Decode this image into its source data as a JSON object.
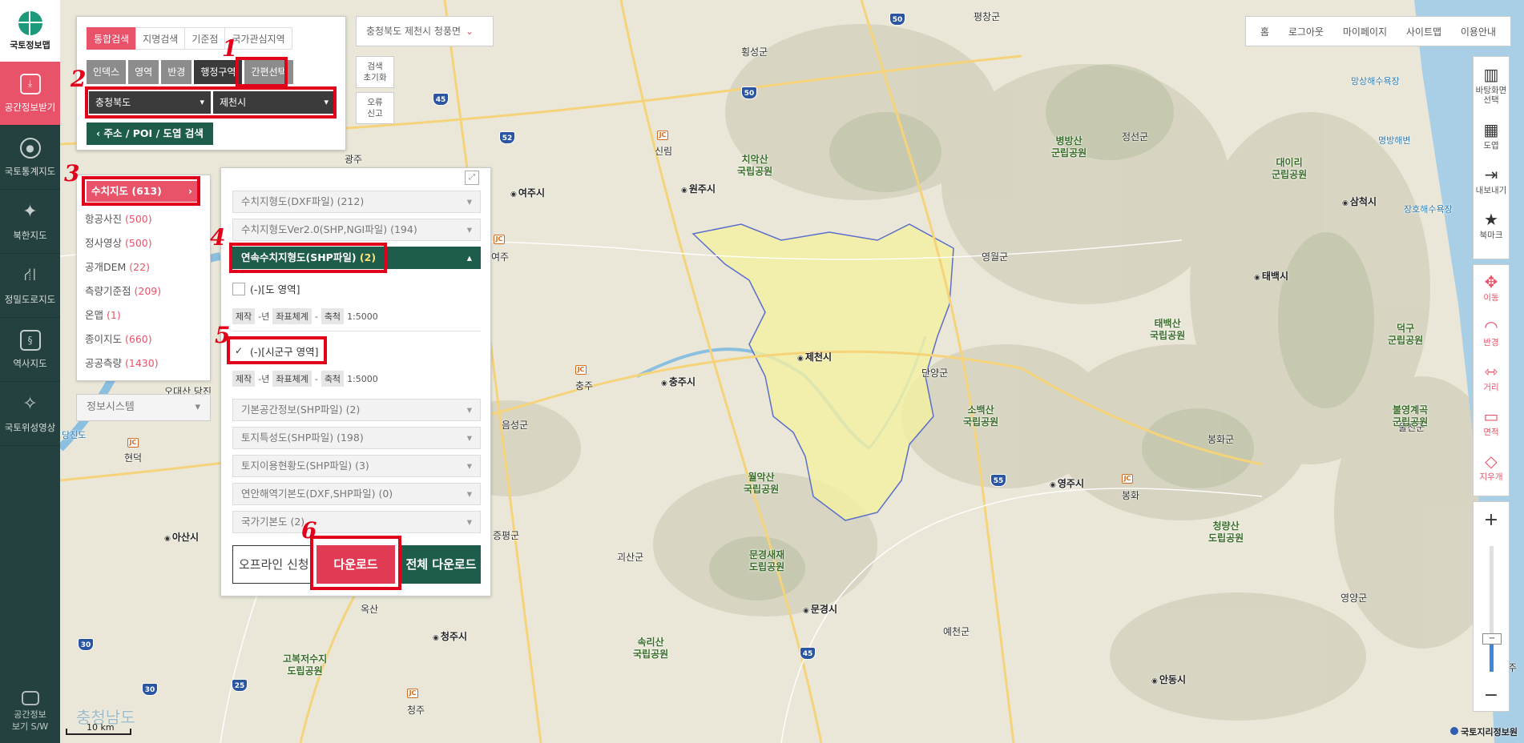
{
  "sidebar": {
    "logo_label": "국토정보맵",
    "items": [
      {
        "label": "공간정보받기",
        "active": true
      },
      {
        "label": "국토통계지도"
      },
      {
        "label": "북한지도"
      },
      {
        "label": "정밀도로지도"
      },
      {
        "label": "역사지도"
      },
      {
        "label": "국토위성영상"
      }
    ],
    "bottom_line1": "공간정보",
    "bottom_line2": "보기 S/W"
  },
  "search": {
    "tabs": [
      "통합검색",
      "지명검색",
      "기준점",
      "국가관심지역"
    ],
    "sub_tabs": [
      "인덱스",
      "영역",
      "반경",
      "행정구역",
      "간편선택"
    ],
    "province": "충청북도",
    "city": "제천시",
    "address_button": "‹  주소 / POI / 도엽 검색"
  },
  "location": {
    "text": "충청북도 제천시 청풍면",
    "chevron": "⌄"
  },
  "mini_buttons": {
    "reset_line1": "검색",
    "reset_line2": "초기화",
    "report_line1": "오류",
    "report_line2": "신고"
  },
  "categories": {
    "items": [
      {
        "name": "수치지도",
        "count": "(613)",
        "active": true
      },
      {
        "name": "항공사진",
        "count": "(500)"
      },
      {
        "name": "정사영상",
        "count": "(500)"
      },
      {
        "name": "공개DEM",
        "count": "(22)"
      },
      {
        "name": "측량기준점",
        "count": "(209)"
      },
      {
        "name": "온맵",
        "count": "(1)"
      },
      {
        "name": "종이지도",
        "count": "(660)"
      },
      {
        "name": "공공측량",
        "count": "(1430)"
      }
    ],
    "arrow": "›",
    "info_system": "정보시스템"
  },
  "download": {
    "expand_icon": "⤢",
    "accordions_top": [
      {
        "name": "수치지형도(DXF파일) (212)"
      },
      {
        "name": "수치지형도Ver2.0(SHP,NGI파일) (194)"
      }
    ],
    "open_accordion": {
      "name": "연속수치지형도(SHP파일)",
      "count": "(2)"
    },
    "items": [
      {
        "label": "(-)[도 영역]",
        "checked": false,
        "check_mark": ""
      },
      {
        "label": "(-)[시군구 영역]",
        "checked": true,
        "check_mark": "✓"
      }
    ],
    "meta": {
      "made": "제작",
      "year": "-년",
      "crs": "좌표체계",
      "dash": "-",
      "scale_label": "축척",
      "scale_value": "1:5000"
    },
    "accordions_bottom": [
      {
        "name": "기본공간정보(SHP파일) (2)"
      },
      {
        "name": "토지특성도(SHP파일) (198)"
      },
      {
        "name": "토지이용현황도(SHP파일) (3)"
      },
      {
        "name": "연안해역기본도(DXF,SHP파일) (0)"
      },
      {
        "name": "국가기본도 (2)"
      }
    ],
    "btn_offline": "오프라인 신청",
    "btn_download": "다운로드",
    "btn_all": "전체 다운로드"
  },
  "annotations": [
    "1",
    "2",
    "3",
    "4",
    "5",
    "6"
  ],
  "top_nav": [
    "홈",
    "로그아웃",
    "마이페이지",
    "사이트맵",
    "이용안내"
  ],
  "right_tools": {
    "group1": [
      {
        "icon": "▥",
        "label": "바탕화면 선택"
      },
      {
        "icon": "▦",
        "label": "도엽"
      },
      {
        "icon": "⇥",
        "label": "내보내기"
      },
      {
        "icon": "★",
        "label": "북마크"
      }
    ],
    "group2": [
      {
        "icon": "✥",
        "label": "이동"
      },
      {
        "icon": "◠",
        "label": "반경"
      },
      {
        "icon": "⇿",
        "label": "거리"
      },
      {
        "icon": "▭",
        "label": "면적"
      },
      {
        "icon": "◇",
        "label": "지우개"
      }
    ],
    "zoom_in": "+",
    "zoom_out": "−",
    "zoom_handle": "−"
  },
  "map": {
    "places": [
      {
        "t": "평창군",
        "k": ""
      },
      {
        "t": "횡성군",
        "k": ""
      },
      {
        "t": "정선군",
        "k": ""
      },
      {
        "t": "원주시",
        "k": "city"
      },
      {
        "t": "여주시",
        "k": "city"
      },
      {
        "t": "영월군",
        "k": ""
      },
      {
        "t": "제천시",
        "k": "city"
      },
      {
        "t": "충주시",
        "k": "city"
      },
      {
        "t": "단양군",
        "k": ""
      },
      {
        "t": "음성군",
        "k": ""
      },
      {
        "t": "영주시",
        "k": "city"
      },
      {
        "t": "봉화군",
        "k": ""
      },
      {
        "t": "괴산군",
        "k": ""
      },
      {
        "t": "문경시",
        "k": "city"
      },
      {
        "t": "예천군",
        "k": ""
      },
      {
        "t": "영양군",
        "k": ""
      },
      {
        "t": "안동시",
        "k": "city"
      },
      {
        "t": "청주시",
        "k": "city"
      },
      {
        "t": "증평군",
        "k": ""
      },
      {
        "t": "아산시",
        "k": "city"
      },
      {
        "t": "태백시",
        "k": "city"
      },
      {
        "t": "삼척시",
        "k": "city"
      },
      {
        "t": "울진군",
        "k": ""
      },
      {
        "t": "옥산",
        "k": ""
      },
      {
        "t": "현덕",
        "k": ""
      },
      {
        "t": "신림",
        "k": ""
      },
      {
        "t": "봉화",
        "k": ""
      },
      {
        "t": "충주",
        "k": ""
      },
      {
        "t": "청주",
        "k": ""
      },
      {
        "t": "광주",
        "k": ""
      },
      {
        "t": "여주",
        "k": ""
      },
      {
        "t": "오대산 당진",
        "k": ""
      },
      {
        "t": "치악산\n국립공원",
        "k": "park"
      },
      {
        "t": "월악산\n국립공원",
        "k": "park"
      },
      {
        "t": "소백산\n국립공원",
        "k": "park"
      },
      {
        "t": "태백산\n국립공원",
        "k": "park"
      },
      {
        "t": "속리산\n국립공원",
        "k": "park"
      },
      {
        "t": "청량산\n도립공원",
        "k": "park"
      },
      {
        "t": "대이리\n군립공원",
        "k": "park"
      },
      {
        "t": "덕구\n군립공원",
        "k": "park"
      },
      {
        "t": "불영계곡\n군립공원",
        "k": "park"
      },
      {
        "t": "문경새재\n도립공원",
        "k": "park"
      },
      {
        "t": "고복저수지\n도립공원",
        "k": "park"
      },
      {
        "t": "병방산\n군립공원",
        "k": "park"
      },
      {
        "t": "망상해수욕장",
        "k": "water"
      },
      {
        "t": "명방해변",
        "k": "water"
      },
      {
        "t": "장호해수욕장",
        "k": "water"
      },
      {
        "t": "충청남도",
        "k": "water"
      },
      {
        "t": "당진도",
        "k": "water"
      },
      {
        "t": "목주",
        "k": ""
      }
    ],
    "shields": [
      "50",
      "45",
      "50",
      "52",
      "55",
      "45",
      "30",
      "30",
      "25"
    ],
    "jc_label": "JC"
  },
  "scale": {
    "label": "10 km"
  },
  "copyright": "국토지리정보원"
}
